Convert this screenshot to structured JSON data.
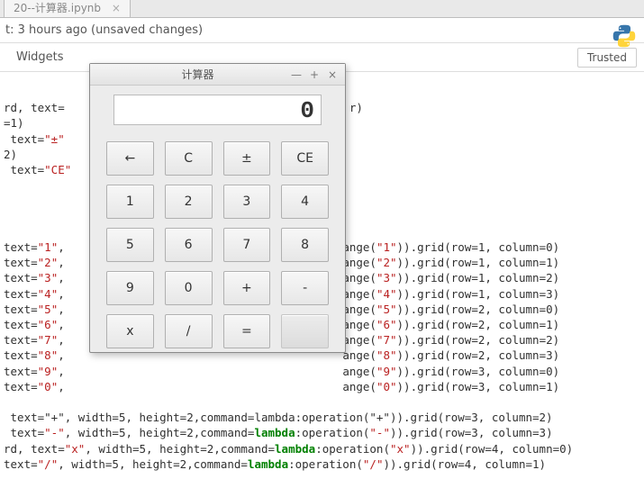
{
  "tab": {
    "title": "20--计算器.ipynb"
  },
  "checkpoint": "t: 3 hours ago (unsaved changes)",
  "toolbar": {
    "widgets": "Widgets",
    "trusted": "Trusted"
  },
  "calc": {
    "title": "计算器",
    "display": "0",
    "win_min": "—",
    "win_max": "+",
    "win_close": "×",
    "r0": [
      "←",
      "C",
      "±",
      "CE"
    ],
    "r1": [
      "1",
      "2",
      "3",
      "4"
    ],
    "r2": [
      "5",
      "6",
      "7",
      "8"
    ],
    "r3": [
      "9",
      "0",
      "+",
      "-"
    ],
    "r4": [
      "x",
      "/",
      "=",
      ""
    ]
  },
  "code": {
    "l1a": "rd, text=",
    "l1b": "r)",
    "l2": "=1)",
    "l3a": " text=",
    "l3q": "\"±\"",
    "l4": "2)",
    "l5a": " text=",
    "l5q": "\"CE\"",
    "b1a": "text=",
    "b1q": "\"1\"",
    "b1c": ",",
    "b1r": "ange(",
    "b1rq": "\"1\"",
    "b1g": ")).grid(row=1, column=0)",
    "b2q": "\"2\"",
    "b2rq": "\"2\"",
    "b2g": ")).grid(row=1, column=1)",
    "b3q": "\"3\"",
    "b3rq": "\"3\"",
    "b3g": ")).grid(row=1, column=2)",
    "b4q": "\"4\"",
    "b4rq": "\"4\"",
    "b4g": ")).grid(row=1, column=3)",
    "b5q": "\"5\"",
    "b5rq": "\"5\"",
    "b5g": ")).grid(row=2, column=0)",
    "b6q": "\"6\"",
    "b6rq": "\"6\"",
    "b6g": ")).grid(row=2, column=1)",
    "b7q": "\"7\"",
    "b7rq": "\"7\"",
    "b7g": ")).grid(row=2, column=2)",
    "b8q": "\"8\"",
    "b8rq": "\"8\"",
    "b8g": ")).grid(row=2, column=3)",
    "b9q": "\"9\"",
    "b9rq": "\"9\"",
    "b9g": ")).grid(row=3, column=0)",
    "b0q": "\"0\"",
    "b0rq": "\"0\"",
    "b0g": ")).grid(row=3, column=1)",
    "opPlus": " text=\"+\", width=5, height=2,command=lambda:operation(\"+\")).grid(row=3, column=2)",
    "opMinusA": " text=",
    "opMinusQ": "\"-\"",
    "opMinusB": ", width=5, height=2,command=",
    "opMinusK": "lambda",
    "opMinusC": ":operation(",
    "opMinusQ2": "\"-\"",
    "opMinusD": ")).grid(row=3, column=3)",
    "opMulA": "rd, text=",
    "opMulQ": "\"x\"",
    "opMulB": ", width=5, height=2,command=",
    "opMulK": "lambda",
    "opMulC": ":operation(",
    "opMulQ2": "\"x\"",
    "opMulD": ")).grid(row=4, column=0)",
    "opDivA": "text=",
    "opDivQ": "\"/\"",
    "opDivB": ", width=5, height=2,command=",
    "opDivK": "lambda",
    "opDivC": ":operation(",
    "opDivQ2": "\"/\"",
    "opDivD": ")).grid(row=4, column=1)"
  },
  "watermark": ""
}
